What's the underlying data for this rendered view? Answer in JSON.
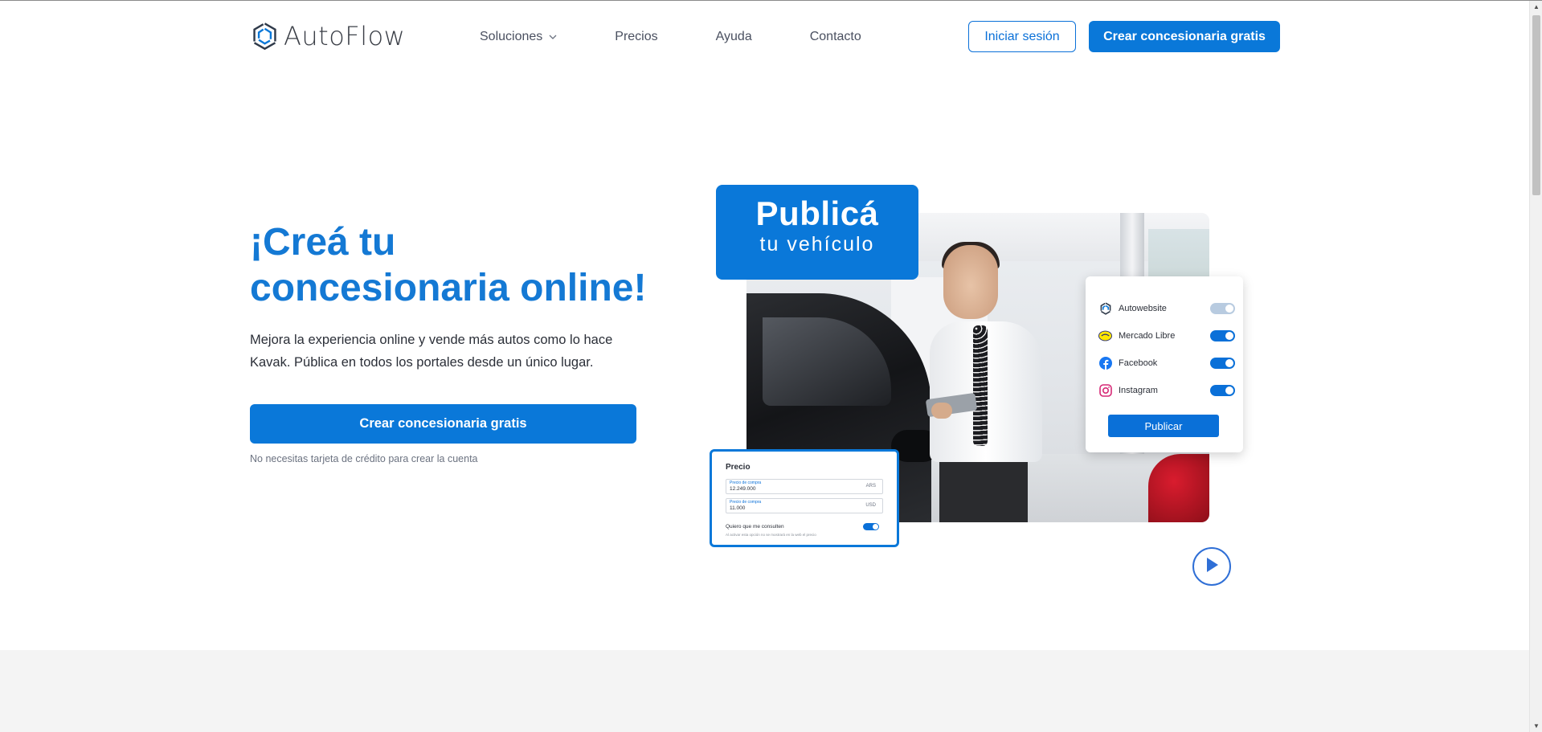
{
  "header": {
    "logo_prefix": "Auto",
    "logo_suffix": "Flow",
    "nav": [
      {
        "label": "Soluciones",
        "has_dropdown": true
      },
      {
        "label": "Precios",
        "has_dropdown": false
      },
      {
        "label": "Ayuda",
        "has_dropdown": false
      },
      {
        "label": "Contacto",
        "has_dropdown": false
      }
    ],
    "login_label": "Iniciar sesión",
    "signup_label": "Crear concesionaria gratis"
  },
  "hero": {
    "title_line1": "¡Creá tu",
    "title_line2": "concesionaria online!",
    "description_line1": "Mejora la experiencia online y vende más autos como lo hace",
    "description_line2": "Kavak. Pública en todos los portales desde un único lugar.",
    "cta_label": "Crear concesionaria gratis",
    "note": "No necesitas tarjeta de crédito para crear la cuenta"
  },
  "visual": {
    "badge_line1": "Publicá",
    "badge_line2": "tu vehículo",
    "portals": [
      {
        "label": "Autowebsite",
        "icon": "autoflow-icon",
        "enabled": false
      },
      {
        "label": "Mercado Libre",
        "icon": "mercadolibre-icon",
        "enabled": true
      },
      {
        "label": "Facebook",
        "icon": "facebook-icon",
        "enabled": true
      },
      {
        "label": "Instagram",
        "icon": "instagram-icon",
        "enabled": true
      }
    ],
    "publish_label": "Publicar",
    "price_card": {
      "title": "Precio",
      "fields": [
        {
          "label": "Precio de compra",
          "value": "12.249.000",
          "currency": "ARS"
        },
        {
          "label": "Precio de compra",
          "value": "11.000",
          "currency": "USD"
        }
      ],
      "question": "Quiero que me consulten",
      "note": "Al activar esta opción no se mostrará en la web el precio"
    },
    "play_icon": "play-icon"
  },
  "colors": {
    "brand_blue": "#0a78d9",
    "title_blue": "#1479d4",
    "toggle_off": "#b8cbe0",
    "band_gray": "#f4f4f4"
  }
}
